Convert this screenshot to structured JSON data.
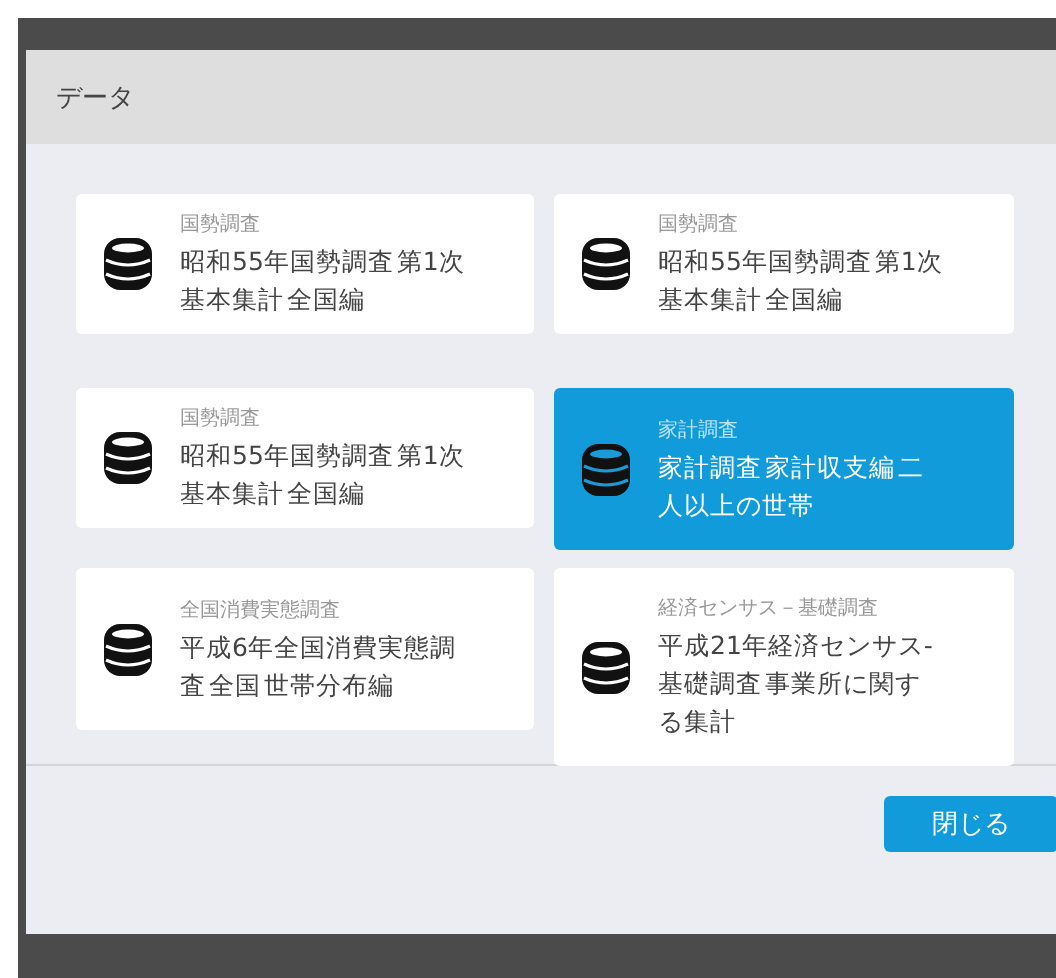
{
  "dialog": {
    "title": "データ",
    "items": [
      {
        "category": "国勢調査",
        "title": "昭和55年国勢調査 第1次基本集計 全国編",
        "selected": false
      },
      {
        "category": "国勢調査",
        "title": "昭和55年国勢調査 第1次基本集計 全国編",
        "selected": false
      },
      {
        "category": "国勢調査",
        "title": "昭和55年国勢調査 第1次基本集計 全国編",
        "selected": false
      },
      {
        "category": "家計調査",
        "title": "家計調査 家計収支編 二人以上の世帯",
        "selected": true
      },
      {
        "category": "全国消費実態調査",
        "title": "平成6年全国消費実態調査 全国 世帯分布編",
        "selected": false
      },
      {
        "category": "経済センサス－基礎調査",
        "title": "平成21年経済センサス-基礎調査 事業所に関する集計",
        "selected": false
      }
    ],
    "buttons": [
      "閉じる"
    ]
  }
}
